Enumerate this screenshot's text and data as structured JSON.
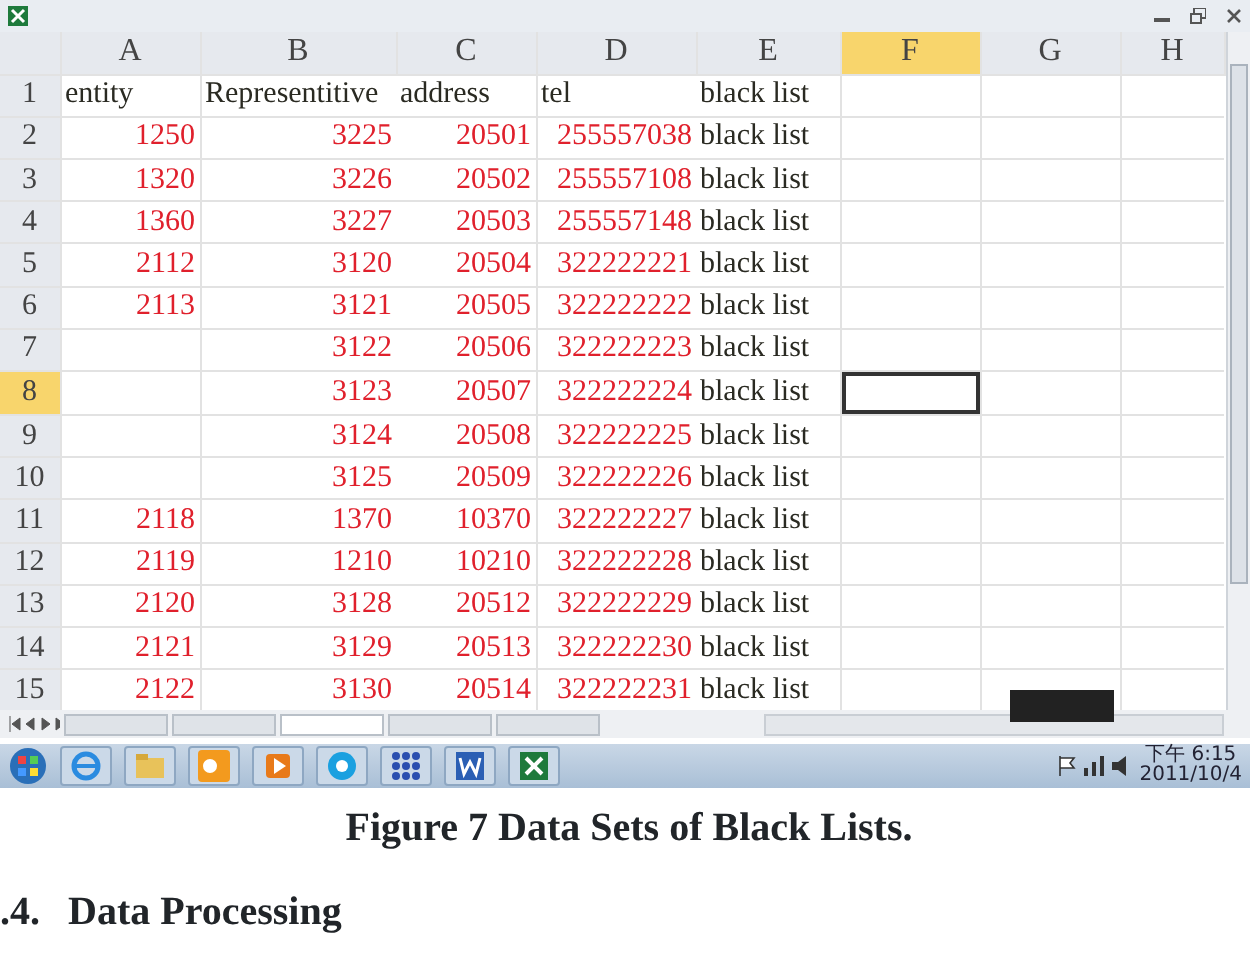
{
  "spreadsheet": {
    "columns": [
      {
        "label": "A",
        "selected": false
      },
      {
        "label": "B",
        "selected": false
      },
      {
        "label": "C",
        "selected": false
      },
      {
        "label": "D",
        "selected": false
      },
      {
        "label": "E",
        "selected": false
      },
      {
        "label": "F",
        "selected": true
      },
      {
        "label": "G",
        "selected": false
      },
      {
        "label": "H",
        "selected": false
      }
    ],
    "rows": [
      {
        "number": "1",
        "selected": false,
        "kind": "header",
        "entity": "entity",
        "representative": "Representitive",
        "address": "address",
        "tel": "tel",
        "list": "black list"
      },
      {
        "number": "2",
        "selected": false,
        "kind": "record",
        "entity": "1250",
        "representative": "3225",
        "address": "20501",
        "tel": "255557038",
        "list": "black list"
      },
      {
        "number": "3",
        "selected": false,
        "kind": "record",
        "entity": "1320",
        "representative": "3226",
        "address": "20502",
        "tel": "255557108",
        "list": "black list"
      },
      {
        "number": "4",
        "selected": false,
        "kind": "record",
        "entity": "1360",
        "representative": "3227",
        "address": "20503",
        "tel": "255557148",
        "list": "black list"
      },
      {
        "number": "5",
        "selected": false,
        "kind": "record",
        "entity": "2112",
        "representative": "3120",
        "address": "20504",
        "tel": "322222221",
        "list": "black list"
      },
      {
        "number": "6",
        "selected": false,
        "kind": "record",
        "entity": "2113",
        "representative": "3121",
        "address": "20505",
        "tel": "322222222",
        "list": "black list"
      },
      {
        "number": "7",
        "selected": false,
        "kind": "record",
        "representative": "3122",
        "address": "20506",
        "tel": "322222223",
        "list": "black list"
      },
      {
        "number": "8",
        "selected": true,
        "kind": "record",
        "representative": "3123",
        "address": "20507",
        "tel": "322222224",
        "list": "black list"
      },
      {
        "number": "9",
        "selected": false,
        "kind": "record",
        "representative": "3124",
        "address": "20508",
        "tel": "322222225",
        "list": "black list"
      },
      {
        "number": "10",
        "selected": false,
        "kind": "record",
        "representative": "3125",
        "address": "20509",
        "tel": "322222226",
        "list": "black list"
      },
      {
        "number": "11",
        "selected": false,
        "kind": "record",
        "entity": "2118",
        "representative": "1370",
        "address": "10370",
        "tel": "322222227",
        "list": "black list"
      },
      {
        "number": "12",
        "selected": false,
        "kind": "record",
        "entity": "2119",
        "representative": "1210",
        "address": "10210",
        "tel": "322222228",
        "list": "black list"
      },
      {
        "number": "13",
        "selected": false,
        "kind": "record",
        "entity": "2120",
        "representative": "3128",
        "address": "20512",
        "tel": "322222229",
        "list": "black list"
      },
      {
        "number": "14",
        "selected": false,
        "kind": "record",
        "entity": "2121",
        "representative": "3129",
        "address": "20513",
        "tel": "322222230",
        "list": "black list"
      },
      {
        "number": "15",
        "selected": false,
        "kind": "record",
        "entity": "2122",
        "representative": "3130",
        "address": "20514",
        "tel": "322222231",
        "list": "black list"
      }
    ],
    "sheet_tabs": [
      {
        "selected": false
      },
      {
        "selected": false
      },
      {
        "selected": true
      },
      {
        "selected": false
      },
      {
        "selected": false
      }
    ]
  },
  "taskbar": {
    "clock_time": "下午 6:15",
    "clock_date": "2011/10/4"
  },
  "caption": "Figure 7 Data Sets of Black Lists.",
  "section_heading": {
    "number": ".4.",
    "title": "Data Processing"
  }
}
